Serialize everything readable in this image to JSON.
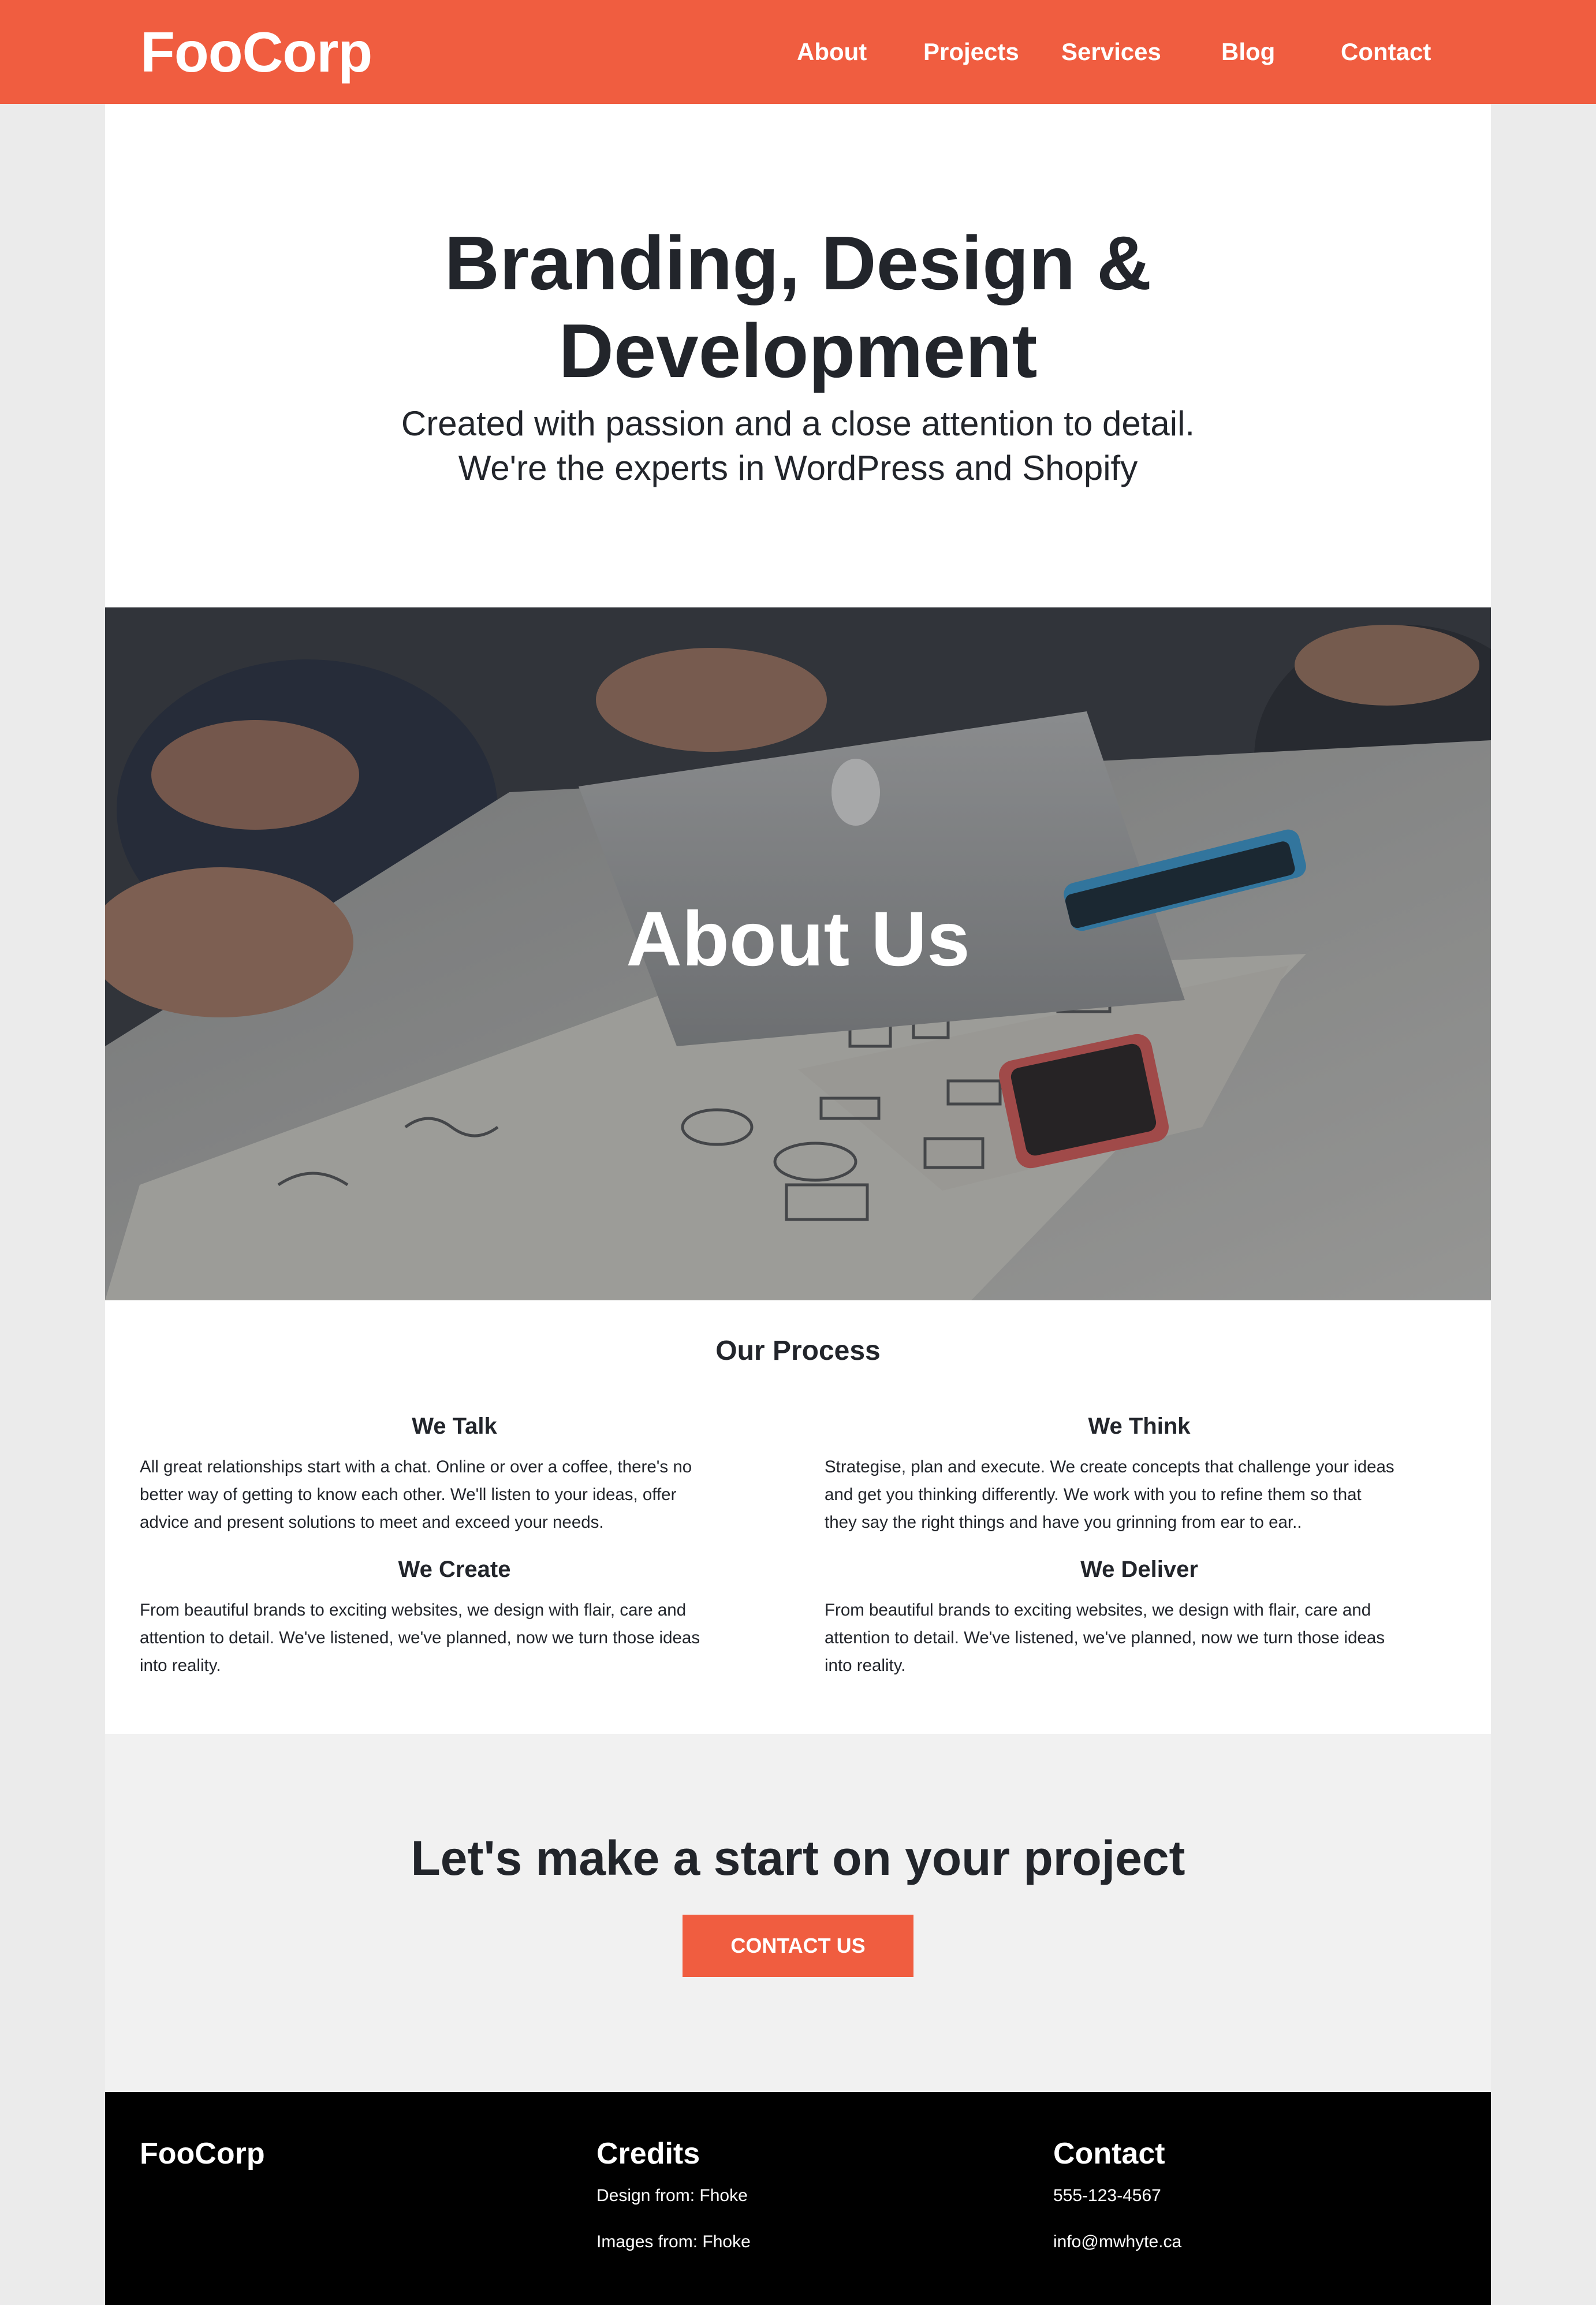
{
  "header": {
    "brand": "FooCorp",
    "nav": [
      "About",
      "Projects",
      "Services",
      "Blog",
      "Contact"
    ]
  },
  "hero": {
    "title_line1": "Branding, Design &",
    "title_line2": "Development",
    "subtitle_line1": "Created with passion and a close attention to detail.",
    "subtitle_line2": "We're the experts in WordPress and Shopify"
  },
  "banner": {
    "title": "About Us"
  },
  "process": {
    "title": "Our Process",
    "steps": [
      {
        "title": "We Talk",
        "lines": [
          "All great relationships start with a chat. Online or over a coffee, there's no",
          "better way of getting to know each other. We'll listen to your ideas, offer",
          "advice and present solutions to meet and exceed your needs."
        ]
      },
      {
        "title": "We Think",
        "lines": [
          "Strategise, plan and execute. We create concepts that challenge your ideas",
          "and get you thinking differently. We work with you to refine them so that",
          "they say the right things and have you grinning from ear to ear.."
        ]
      },
      {
        "title": "We Create",
        "lines": [
          "From beautiful brands to exciting websites, we design with flair, care and",
          "attention to detail. We've listened, we've planned, now we turn those ideas",
          "into reality."
        ]
      },
      {
        "title": "We Deliver",
        "lines": [
          "From beautiful brands to exciting websites, we design with flair, care and",
          "attention to detail. We've listened, we've planned, now we turn those ideas",
          "into reality."
        ]
      }
    ]
  },
  "cta": {
    "title": "Let's make a start on your project",
    "button": "CONTACT US"
  },
  "footer": {
    "brand": "FooCorp",
    "credits_title": "Credits",
    "credits": [
      "Design from: Fhoke",
      "Images from: Fhoke"
    ],
    "contact_title": "Contact",
    "contact": [
      "555-123-4567",
      "info@mwhyte.ca"
    ]
  },
  "colors": {
    "accent": "#f05d40",
    "text": "#22252b",
    "cta_bg": "#f1f1f1",
    "footer_bg": "#000000",
    "page_bg": "#ebebeb"
  }
}
